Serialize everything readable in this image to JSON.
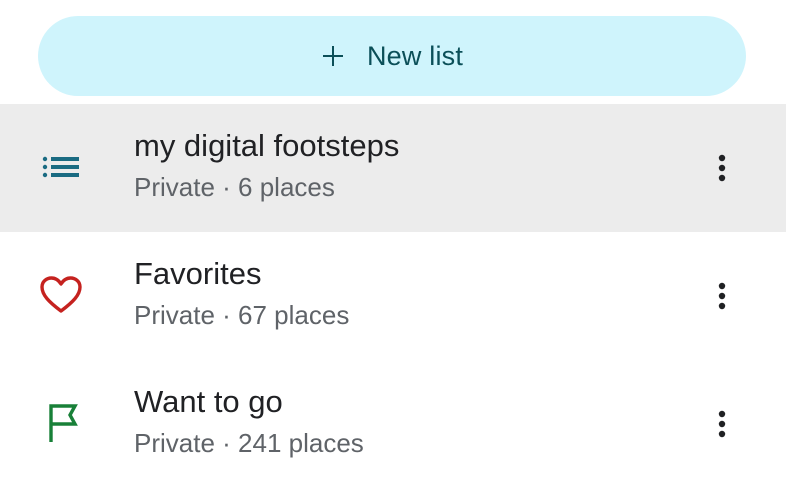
{
  "new_list_button": {
    "label": "New list",
    "icon": "plus-icon"
  },
  "lists": [
    {
      "title": "my digital footsteps",
      "privacy": "Private",
      "count": "6 places",
      "subtitle": "Private · 6 places",
      "icon": "list-icon",
      "icon_color": "#1a6b82",
      "selected": true
    },
    {
      "title": "Favorites",
      "privacy": "Private",
      "count": "67 places",
      "subtitle": "Private · 67 places",
      "icon": "heart-icon",
      "icon_color": "#c5221f",
      "selected": false
    },
    {
      "title": "Want to go",
      "privacy": "Private",
      "count": "241 places",
      "subtitle": "Private · 241 places",
      "icon": "flag-icon",
      "icon_color": "#188038",
      "selected": false
    }
  ],
  "colors": {
    "button_bg": "#cff4fc",
    "button_text": "#0b4f58",
    "selected_row_bg": "#ececec",
    "title_text": "#202124",
    "subtitle_text": "#5f6368"
  }
}
